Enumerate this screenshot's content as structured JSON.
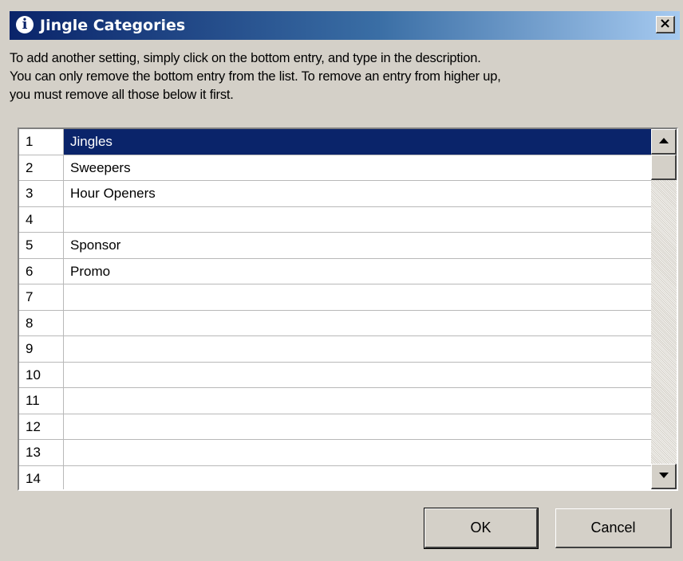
{
  "window": {
    "title": "Jingle Categories",
    "title_icon": "info-icon",
    "close_label": "×"
  },
  "instructions": {
    "line1": "To add another setting, simply click on the bottom entry, and type in the description.",
    "line2": "You can only remove the bottom entry from the list. To remove an entry from higher up,",
    "line3": "you must remove all those below it first."
  },
  "list": {
    "selected_index": 0,
    "rows": [
      {
        "num": "1",
        "desc": "Jingles"
      },
      {
        "num": "2",
        "desc": "Sweepers"
      },
      {
        "num": "3",
        "desc": "Hour Openers"
      },
      {
        "num": "4",
        "desc": ""
      },
      {
        "num": "5",
        "desc": "Sponsor"
      },
      {
        "num": "6",
        "desc": "Promo"
      },
      {
        "num": "7",
        "desc": ""
      },
      {
        "num": "8",
        "desc": ""
      },
      {
        "num": "9",
        "desc": ""
      },
      {
        "num": "10",
        "desc": ""
      },
      {
        "num": "11",
        "desc": ""
      },
      {
        "num": "12",
        "desc": ""
      },
      {
        "num": "13",
        "desc": ""
      },
      {
        "num": "14",
        "desc": ""
      }
    ]
  },
  "scrollbar": {
    "up_icon": "arrow-up-icon",
    "down_icon": "arrow-down-icon"
  },
  "buttons": {
    "ok_label": "OK",
    "cancel_label": "Cancel"
  },
  "colors": {
    "title_start": "#0a246a",
    "selection": "#0a246a",
    "face": "#d4d0c8"
  }
}
